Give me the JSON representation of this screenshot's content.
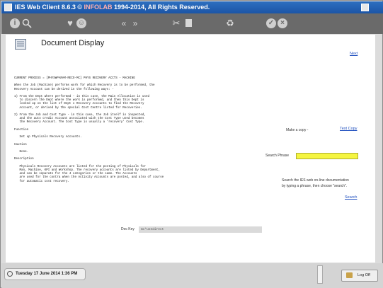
{
  "window": {
    "title_prefix": "IES Web Client 8.6.3 ©",
    "title_brand": "INFOLAB",
    "title_suffix": "1994-2014, All Rights Reserved."
  },
  "toolbar": {
    "icons": [
      "info-icon",
      "search-icon",
      "heart-icon",
      "smiley-icon",
      "back-icon",
      "forward-icon",
      "tools-icon",
      "blank-page-icon",
      "recycle-icon",
      "check-icon",
      "cancel-icon"
    ]
  },
  "page": {
    "title": "Document Display",
    "next_link": "Next"
  },
  "document": {
    "text": "CURRENT PROCESS = [PHYSWPARAM-RECO-MC] PHYS RECOVERY ACCTS - MACHINE\n\nWhen the Job (Machine) performs work for which Recovery is to be performed, the\nRecovery Account can be derived in the following ways: -\n\n1) From the Dept where performed - in this case, the Main Allocation is used\n   to discern the Dept where the work is performed, and then this Dept is\n   looked up on the list of Dept x Recovery Accounts to find the Recovery\n   Account, or derived by the special Cost Centre listed for Recoveries.\n\n2) From the Job and Cost Type - in this case, the Job itself is inspected,\n   and the auto credit Account associated with the Cost Type used becomes\n   the Recovery Account. The Cost Type is usually a 'recovery' Cost Type.\n\nFunction\n\n   Set up Physicals Recovery Accounts.\n\nCaution\n\n   None.\n\nDescription\n\n   Physicals Recovery Accounts are listed for the posting of Physicals for\n   Man, Machine, KPI and Workshop. The recovery accounts are listed by Department,\n   and can be separate for the 4 categories or the same. The Accounts\n   are used for the contra when the Activity Accounts are posted, and also of course\n   for automatic cost recovery.",
    "doc_key_label": "Doc Key",
    "doc_key_value": "mc*usedirect"
  },
  "side": {
    "make_copy_label": "Make a copy -",
    "text_copy_link": "Text Copy",
    "search_phrase_label": "Search Phrase",
    "search_help_line1": "Search the IES web on-line documentation",
    "search_help_line2": "by typing a phrase, then choose \"search\".",
    "search_link": "Search"
  },
  "status": {
    "date": "Tuesday 17 June 2014 1:36 PM",
    "logoff_label": "Log Off"
  }
}
